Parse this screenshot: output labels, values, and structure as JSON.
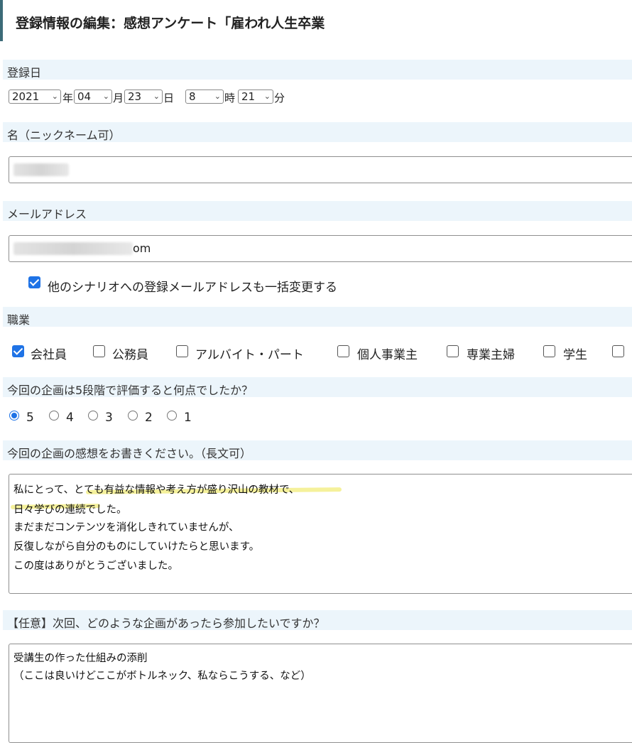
{
  "page": {
    "title": "登録情報の編集：感想アンケート「雇われ人生卒業"
  },
  "registration_date": {
    "label": "登録日",
    "year": "2021",
    "year_unit": "年",
    "month": "04",
    "month_unit": "月",
    "day": "23",
    "day_unit": "日",
    "hour": "8",
    "hour_unit": "時",
    "minute": "21",
    "minute_unit": "分"
  },
  "name": {
    "label": "名（ニックネーム可）"
  },
  "email": {
    "label": "メールアドレス",
    "visible_suffix": "om",
    "bulk_change_label": "他のシナリオへの登録メールアドレスも一括変更する",
    "bulk_change_checked": true
  },
  "occupation": {
    "label": "職業",
    "options": [
      {
        "label": "会社員",
        "checked": true
      },
      {
        "label": "公務員",
        "checked": false
      },
      {
        "label": "アルバイト・パート",
        "checked": false
      },
      {
        "label": "個人事業主",
        "checked": false
      },
      {
        "label": "専業主婦",
        "checked": false
      },
      {
        "label": "学生",
        "checked": false
      },
      {
        "label": "",
        "checked": false
      }
    ]
  },
  "rating": {
    "label": "今回の企画は5段階で評価すると何点でしたか？",
    "options": [
      "5",
      "4",
      "3",
      "2",
      "1"
    ],
    "selected": "5"
  },
  "impression": {
    "label": "今回の企画の感想をお書きください。（長文可）",
    "lines": [
      "私にとって、とても有益な情報や考え方が盛り沢山の教材で、",
      "日々学びの連続でした。",
      "まだまだコンテンツを消化しきれていませんが、",
      "反復しながら自分のものにしていけたらと思います。",
      "この度はありがとうございました。"
    ],
    "highlight_color": "#f2ec7a"
  },
  "next_plan": {
    "label": "【任意】次回、どのような企画があったら参加したいですか？",
    "lines": [
      "受講生の作った仕組みの添削",
      "（ここは良いけどここがボトルネック、私ならこうする、など）"
    ]
  },
  "colors": {
    "accent": "#1f73e6",
    "section_bg": "#ecf5fb",
    "title_border": "#3c6b78"
  }
}
